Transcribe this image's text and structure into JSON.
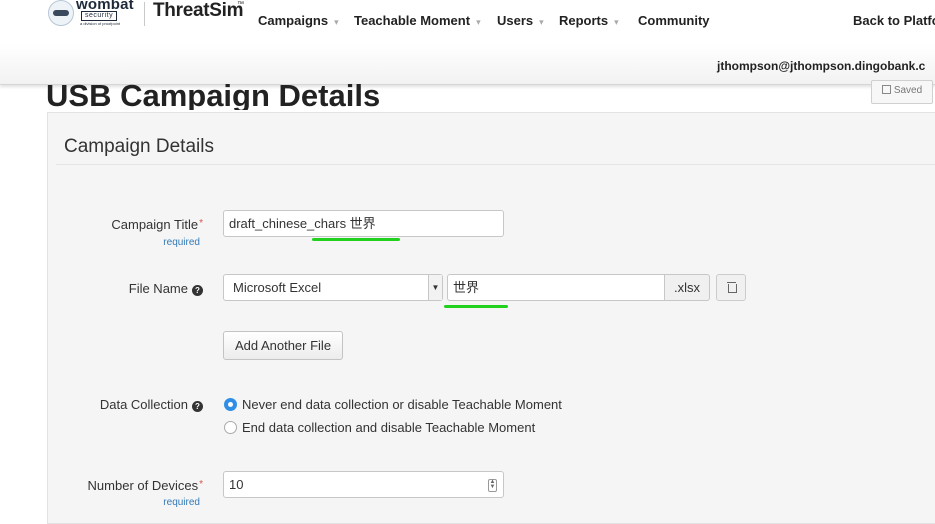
{
  "nav": {
    "logo_word": "wombat",
    "logo_sub1": "security",
    "logo_sub2": "a division of proofpoint",
    "brand": "ThreatSim",
    "brand_tm": "™",
    "items": [
      {
        "label": "Campaigns",
        "has_caret": true
      },
      {
        "label": "Teachable Moment",
        "has_caret": true
      },
      {
        "label": "Users",
        "has_caret": true
      },
      {
        "label": "Reports",
        "has_caret": true
      },
      {
        "label": "Community",
        "has_caret": false
      }
    ],
    "caret": "▾",
    "back_link": "Back to Platfo",
    "user_email": "jthompson@jthompson.dingobank.c"
  },
  "page": {
    "title": "USB Campaign Details",
    "saved_label": "Saved"
  },
  "panel": {
    "title": "Campaign Details",
    "required_note": "required",
    "required_star": "*",
    "help_glyph": "?",
    "campaign_title": {
      "label": "Campaign Title",
      "value": "draft_chinese_chars 世界"
    },
    "file_name": {
      "label": "File Name",
      "type_selected": "Microsoft Excel",
      "value": "世界",
      "extension": ".xlsx"
    },
    "add_file_label": "Add Another File",
    "data_collection": {
      "label": "Data Collection",
      "options": [
        {
          "label": "Never end data collection or disable Teachable Moment",
          "checked": true
        },
        {
          "label": "End data collection and disable Teachable Moment",
          "checked": false
        }
      ]
    },
    "devices": {
      "label": "Number of Devices",
      "value": "10"
    }
  },
  "colors": {
    "accent_radio": "#2f8fe6",
    "annotation_marker": "#22d11e",
    "required": "#d9534f",
    "required_link": "#337ab7"
  },
  "icons": {
    "logo": "wombat-logo-icon",
    "help": "question-circle-icon",
    "trash": "trash-icon",
    "saved": "floppy-disk-icon",
    "select": "chevron-down-icon",
    "spinner": "spinner-arrows-icon"
  }
}
